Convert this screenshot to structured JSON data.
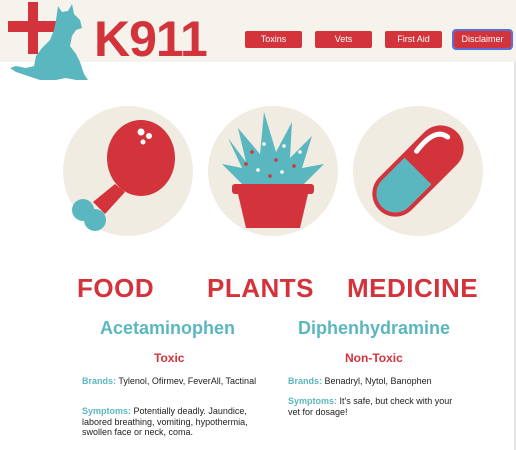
{
  "header": {
    "logo_text": "K911",
    "nav": [
      {
        "label": "Toxins"
      },
      {
        "label": "Vets"
      },
      {
        "label": "First Aid"
      },
      {
        "label": "Disclaimer"
      }
    ]
  },
  "categories": [
    {
      "label": "FOOD"
    },
    {
      "label": "PLANTS"
    },
    {
      "label": "MEDICINE"
    }
  ],
  "drugs": [
    {
      "name": "Acetaminophen",
      "status": "Toxic",
      "brands_label": "Brands:",
      "brands": "Tylenol, Ofirmev, FeverAll, Tactinal",
      "symptoms_label": "Symptoms:",
      "symptoms": "Potentially deadly. Jaundice, labored breathing, vomiting, hypothermia, swollen face or neck, coma."
    },
    {
      "name": "Diphenhydramine",
      "status": "Non-Toxic",
      "brands_label": "Brands:",
      "brands": "Benadryl, Nytol, Banophen",
      "symptoms_label": "Symptoms:",
      "symptoms": "It's safe, but check with your vet for dosage!"
    }
  ],
  "colors": {
    "brand_red": "#d3333b",
    "teal": "#5bb7bf",
    "cream": "#f1ece2"
  }
}
